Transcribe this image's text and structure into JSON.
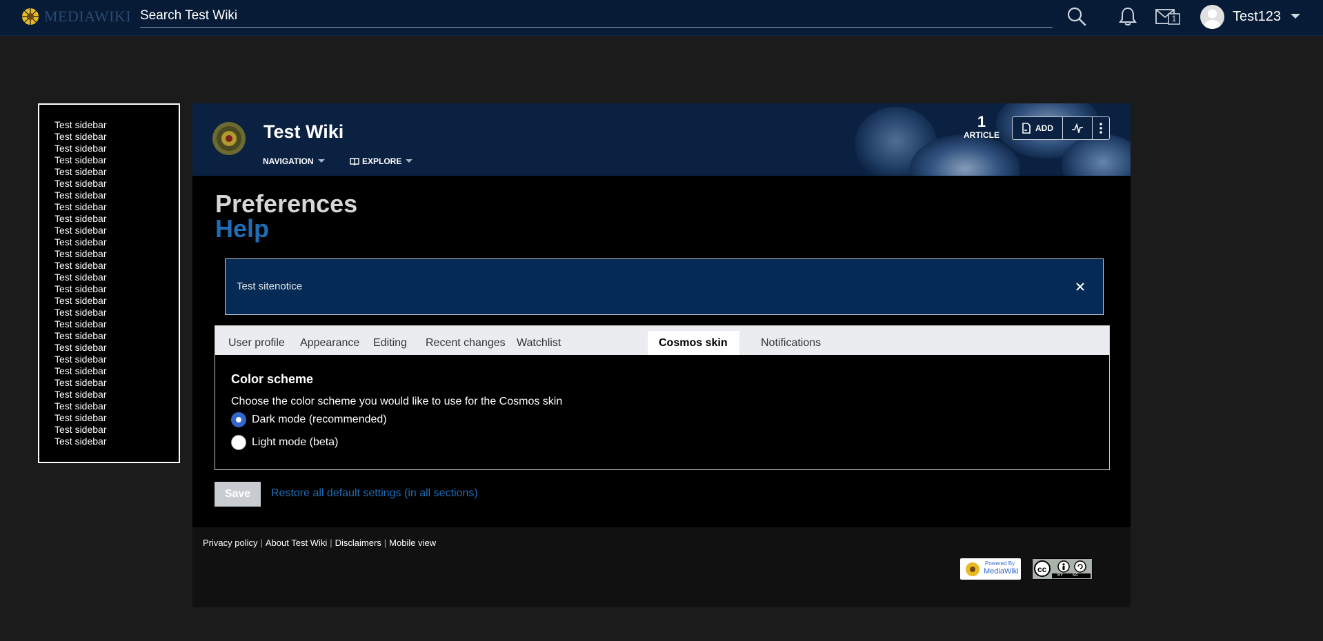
{
  "topbar": {
    "logo_text": "MEDIAWIKI",
    "search_placeholder": "Search Test Wiki",
    "username": "Test123",
    "notice_count": "1"
  },
  "sidebar": {
    "items": [
      "Test sidebar",
      "Test sidebar",
      "Test sidebar",
      "Test sidebar",
      "Test sidebar",
      "Test sidebar",
      "Test sidebar",
      "Test sidebar",
      "Test sidebar",
      "Test sidebar",
      "Test sidebar",
      "Test sidebar",
      "Test sidebar",
      "Test sidebar",
      "Test sidebar",
      "Test sidebar",
      "Test sidebar",
      "Test sidebar",
      "Test sidebar",
      "Test sidebar",
      "Test sidebar",
      "Test sidebar",
      "Test sidebar",
      "Test sidebar",
      "Test sidebar",
      "Test sidebar",
      "Test sidebar",
      "Test sidebar"
    ]
  },
  "header": {
    "wiki_title": "Test Wiki",
    "nav_label": "NAVIGATION",
    "explore_label": "EXPLORE",
    "article_count": "1",
    "article_label": "ARTICLE",
    "add_label": "ADD"
  },
  "content": {
    "page_title": "Preferences",
    "help_label": "Help",
    "sitenotice": "Test sitenotice",
    "tabs": [
      "User profile",
      "Appearance",
      "Editing",
      "Recent changes",
      "Watchlist",
      "Cosmos skin",
      "Notifications"
    ],
    "active_tab": "Cosmos skin",
    "section_title": "Color scheme",
    "section_desc": "Choose the color scheme you would like to use for the Cosmos skin",
    "options": [
      {
        "label": "Dark mode (recommended)",
        "selected": true
      },
      {
        "label": "Light mode (beta)",
        "selected": false
      }
    ],
    "save_label": "Save",
    "restore_label": "Restore all default settings (in all sections)"
  },
  "footer": {
    "links": [
      "Privacy policy",
      "About Test Wiki",
      "Disclaimers",
      "Mobile view"
    ],
    "powered_by_top": "Powered By",
    "powered_by_bottom": "MediaWiki",
    "license_badge": "BY SA"
  },
  "colors": {
    "topbar_bg": "#071b36",
    "header_bg": "#0a2142",
    "accent_link": "#1f6db5",
    "sitenotice_bg": "#042a55",
    "radio_selected": "#3366cc"
  }
}
